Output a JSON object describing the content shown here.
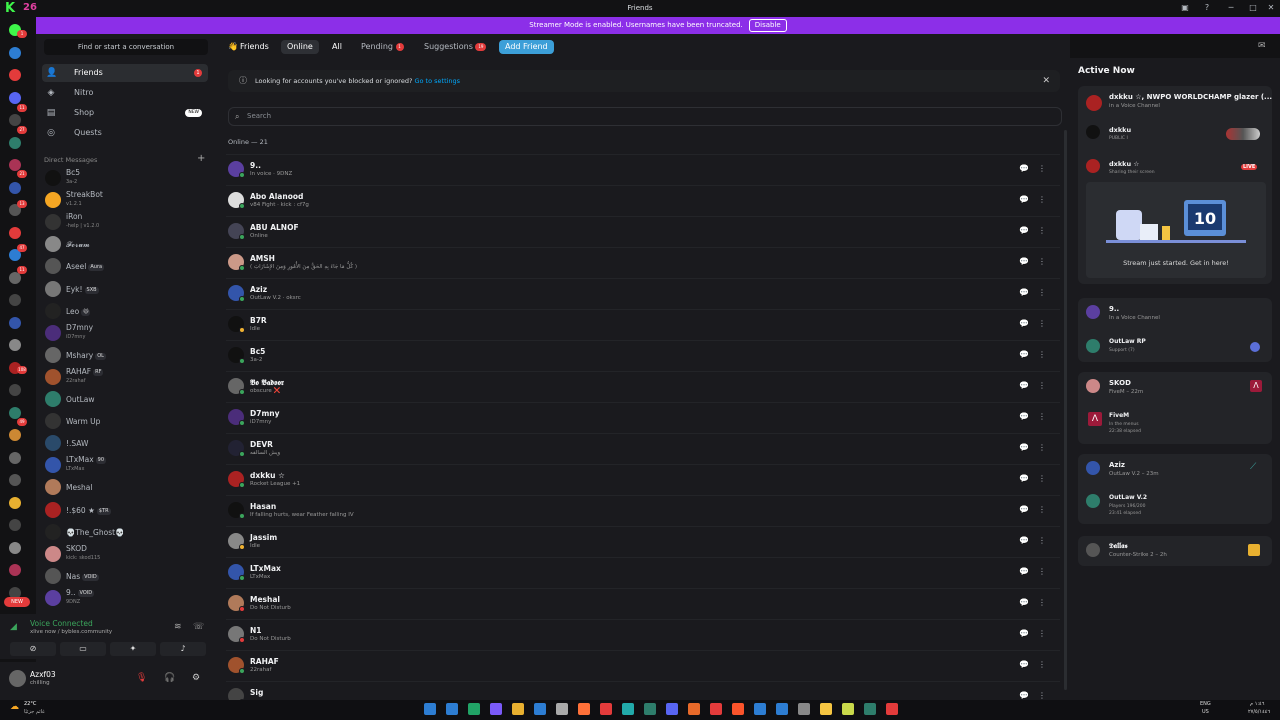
{
  "window": {
    "title": "Friends",
    "menu_icon": "inbox-icon",
    "help_icon": "help-icon",
    "min": "─",
    "max": "□",
    "close": "✕"
  },
  "banner": {
    "text": "Streamer Mode is enabled. Usernames have been truncated.",
    "button": "Disable"
  },
  "servers": {
    "badges": [
      "1",
      "11",
      "27",
      "21",
      "13",
      "47",
      "11",
      "108",
      "49"
    ],
    "new_label": "NEW"
  },
  "sidebar": {
    "search_placeholder": "Find or start a conversation",
    "nav": [
      {
        "label": "Friends",
        "badge": "1"
      },
      {
        "label": "Nitro"
      },
      {
        "label": "Shop",
        "badge": "NEW"
      },
      {
        "label": "Quests"
      }
    ],
    "dm_header": "Direct Messages",
    "dm_add": "+",
    "dms": [
      {
        "name": "Bc5",
        "sub": "3a-2",
        "color": "#111"
      },
      {
        "name": "StreakBot",
        "sub": "v1.2.1",
        "color": "#f5a623"
      },
      {
        "name": "iRon",
        "sub": "-help | v1.2.0",
        "color": "#333"
      },
      {
        "name": "𝓕𝓸𝓻𝓾𝓶",
        "sub": "",
        "color": "#888"
      },
      {
        "name": "Aseel",
        "tag": "Aura",
        "sub": "",
        "color": "#555"
      },
      {
        "name": "Eyk!",
        "tag": "SXB",
        "sub": "",
        "color": "#777"
      },
      {
        "name": "Leo",
        "tag": "🐱",
        "sub": "",
        "color": "#222"
      },
      {
        "name": "D7mny",
        "sub": "iD7mny",
        "color": "#4b2d7a"
      },
      {
        "name": "Mshary",
        "tag": "OL",
        "sub": "",
        "color": "#666"
      },
      {
        "name": "RAHAF",
        "tag": "RF",
        "sub": "22rahaf",
        "color": "#a0522d"
      },
      {
        "name": "OutLaw",
        "sub": "",
        "color": "#2e7d6b"
      },
      {
        "name": "Warm Up",
        "sub": "",
        "color": "#333"
      },
      {
        "name": "!.SAW",
        "sub": "",
        "color": "#2a4a6a"
      },
      {
        "name": "LTxMax",
        "tag": "90",
        "sub": "LTxMax",
        "color": "#3355aa"
      },
      {
        "name": "Meshal",
        "sub": "",
        "color": "#b07a5a"
      },
      {
        "name": "!.$60 ★",
        "tag": "$TR",
        "sub": "",
        "color": "#aa2222"
      },
      {
        "name": "💀The_Ghost💀",
        "sub": "",
        "color": "#222"
      },
      {
        "name": "SKOD",
        "sub": "kick: skod115",
        "color": "#c88"
      },
      {
        "name": "Nas",
        "tag": "VOID",
        "sub": "",
        "color": "#555"
      },
      {
        "name": "9..",
        "tag": "VOID",
        "sub": "9DNZ",
        "color": "#5b3fa0"
      }
    ]
  },
  "voice": {
    "title": "Voice Connected",
    "sub": "xlive now / bybles.community"
  },
  "user": {
    "name": "Azxf03",
    "status": "chilling"
  },
  "tabs": {
    "friends": "Friends",
    "online": "Online",
    "all": "All",
    "pending": "Pending",
    "pending_count": "1",
    "suggestions": "Suggestions",
    "suggestions_count": "19",
    "add": "Add Friend"
  },
  "hint": {
    "text": "Looking for accounts you've blocked or ignored?",
    "link": "Go to settings"
  },
  "search": {
    "placeholder": "Search"
  },
  "online_header": "Online — 21",
  "friends": [
    {
      "name": "9..",
      "status": "In voice · 9DNZ",
      "color": "#5b3fa0"
    },
    {
      "name": "Abo Alanood",
      "status": "v84 Fight · kick : cf7g",
      "color": "#ddd"
    },
    {
      "name": "ABU ALNOF",
      "status": "Online",
      "color": "#445"
    },
    {
      "name": "AMSH",
      "status": "( كُلُّ مَا جَاءَ بِهِ الحَقُّ مِنَ الأُمُورِ وَمِنَ الإِشَارَاتِ )",
      "color": "#c98"
    },
    {
      "name": "Aziz",
      "status": "OutLaw V.2 · oksrc",
      "color": "#3355aa"
    },
    {
      "name": "B7R",
      "status": "Idle",
      "color": "#111"
    },
    {
      "name": "Bc5",
      "status": "3a-2",
      "color": "#111"
    },
    {
      "name": "𝕭𝖔 𝕭𝖆𝖉𝖔𝖔𝖗",
      "status": "obscure ❌",
      "color": "#666"
    },
    {
      "name": "D7mny",
      "status": "iD7mny",
      "color": "#4b2d7a"
    },
    {
      "name": "DEVR",
      "status": "ويش السالفه",
      "color": "#223"
    },
    {
      "name": "dxkku ☆",
      "status": "Rocket League +1",
      "color": "#a22"
    },
    {
      "name": "Hasan",
      "status": "If falling hurts, wear Feather falling IV",
      "color": "#111"
    },
    {
      "name": "Jassim",
      "status": "Idle",
      "color": "#888"
    },
    {
      "name": "LTxMax",
      "status": "LTxMax",
      "color": "#3355aa"
    },
    {
      "name": "Meshal",
      "status": "Do Not Disturb",
      "color": "#b07a5a"
    },
    {
      "name": "N1",
      "status": "Do Not Disturb",
      "color": "#777"
    },
    {
      "name": "RAHAF",
      "status": "22rahaf",
      "color": "#a0522d"
    },
    {
      "name": "Sig",
      "status": "",
      "color": "#444"
    }
  ],
  "active": {
    "title": "Active Now",
    "c1": {
      "name": "dxkku ☆, NWPO WORLDCHAMP glazer (...",
      "sub": "in a Voice Channel",
      "m1": "dxkku",
      "m1s": "PUBLIC I",
      "m2": "dxkku ☆",
      "m2s": "Sharing their screen",
      "live": "LIVE",
      "stream_caption": "Stream just started. Get in here!"
    },
    "c2": {
      "name": "9..",
      "sub": "In a Voice Channel",
      "m1": "OutLaw RP",
      "m1s": "Support (7)"
    },
    "c3": {
      "name": "SKOD",
      "sub": "FiveM – 22m",
      "m1": "FiveM",
      "m1s": "In the menus",
      "m1t": "22:38 elapsed"
    },
    "c4": {
      "name": "Aziz",
      "sub": "OutLaw V.2 – 23m",
      "m1": "OutLaw V.2",
      "m1s": "Players 196/200",
      "m1t": "23:41 elapsed"
    },
    "c5": {
      "name": "𝕯𝖆𝖑𝖑𝖆𝖘",
      "sub": "Counter-Strike 2 – 2h"
    }
  },
  "taskbar": {
    "temp": "22°C",
    "weather": "غائم جزئيًا",
    "lang": "ENG",
    "lang2": "US",
    "time": "١:٤٦ م",
    "date": "٢٧/٥/١٤٤٦"
  },
  "colors": {
    "accent": "#8c2fe8",
    "online": "#3ba55c",
    "danger": "#e33b3b",
    "link": "#00a8fc"
  }
}
